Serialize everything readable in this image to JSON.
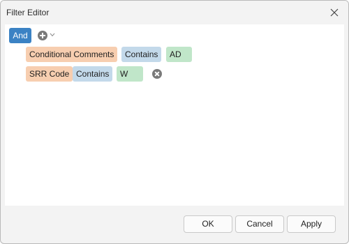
{
  "window": {
    "title": "Filter Editor"
  },
  "filter": {
    "group_operator": "And",
    "conditions": [
      {
        "field": "Conditional Comments",
        "operator": "Contains",
        "value": "AD"
      },
      {
        "field": "SRR Code",
        "operator": "Contains",
        "value": "W"
      }
    ]
  },
  "icons": {
    "close": "close-icon",
    "add": "plus-circle-icon",
    "dropdown": "chevron-down-icon",
    "remove": "remove-circle-icon"
  },
  "colors": {
    "group_operator": "#3b82c4",
    "field_chip": "#f7ceb0",
    "operator_chip": "#c3d9ea",
    "value_chip": "#c0e6c9"
  },
  "footer": {
    "ok_label": "OK",
    "cancel_label": "Cancel",
    "apply_label": "Apply"
  }
}
